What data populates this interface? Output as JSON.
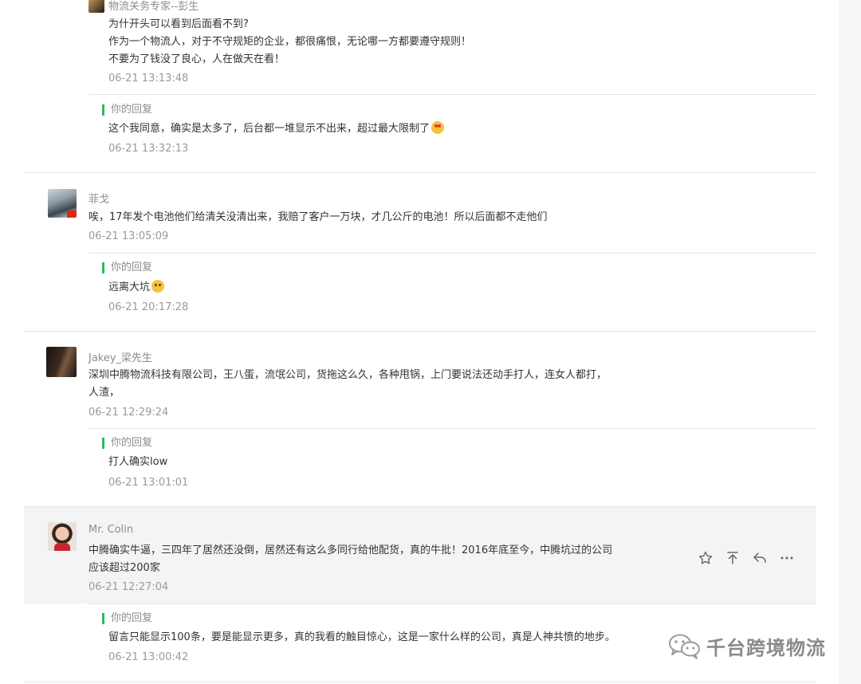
{
  "comments": [
    {
      "nickname": "物流关务专家--彭生",
      "lines": [
        "为什开头可以看到后面看不到?",
        "作为一个物流人，对于不守规矩的企业，都很痛恨，无论哪一方都要遵守规则！",
        "不要为了钱没了良心，人在做天在看！"
      ],
      "time": "06-21 13:13:48",
      "reply": {
        "label": "你的回复",
        "text": "这个我同意，确实是太多了，后台都一堆显示不出来，超过最大限制了",
        "time": "06-21 13:32:13",
        "emoji": "heart-eyes"
      }
    },
    {
      "nickname": "菲戈",
      "lines": [
        "唉，17年发个电池他们给清关没清出来，我赔了客户一万块，才几公斤的电池！所以后面都不走他们"
      ],
      "time": "06-21 13:05:09",
      "reply": {
        "label": "你的回复",
        "text": "远离大坑",
        "time": "06-21 20:17:28",
        "emoji": "smile"
      }
    },
    {
      "nickname": "Jakey_梁先生",
      "lines": [
        "深圳中腾物流科技有限公司，王八蛋，流氓公司，货拖这么久，各种甩锅，上门要说法还动手打人，连女人都打，",
        "人渣，"
      ],
      "time": "06-21 12:29:24",
      "reply": {
        "label": "你的回复",
        "text": "打人确实low",
        "time": "06-21 13:01:01"
      }
    },
    {
      "nickname": "Mr. Colin",
      "lines": [
        "中腾确实牛逼，三四年了居然还没倒，居然还有这么多同行给他配货，真的牛批！2016年底至今，中腾坑过的公司",
        "应该超过200家"
      ],
      "time": "06-21 12:27:04",
      "reply": {
        "label": "你的回复",
        "text": "留言只能显示100条，要是能显示更多，真的我看的触目惊心，这是一家什么样的公司，真是人神共愤的地步。",
        "time": "06-21 13:00:42"
      }
    }
  ],
  "actions": [
    "star-icon",
    "pin-top-icon",
    "reply-icon",
    "more-icon"
  ],
  "watermark": {
    "text": "千台跨境物流"
  },
  "colors": {
    "accent": "#2fb865",
    "hover_bg": "#f3f4f5",
    "muted": "#9a9a9a"
  }
}
